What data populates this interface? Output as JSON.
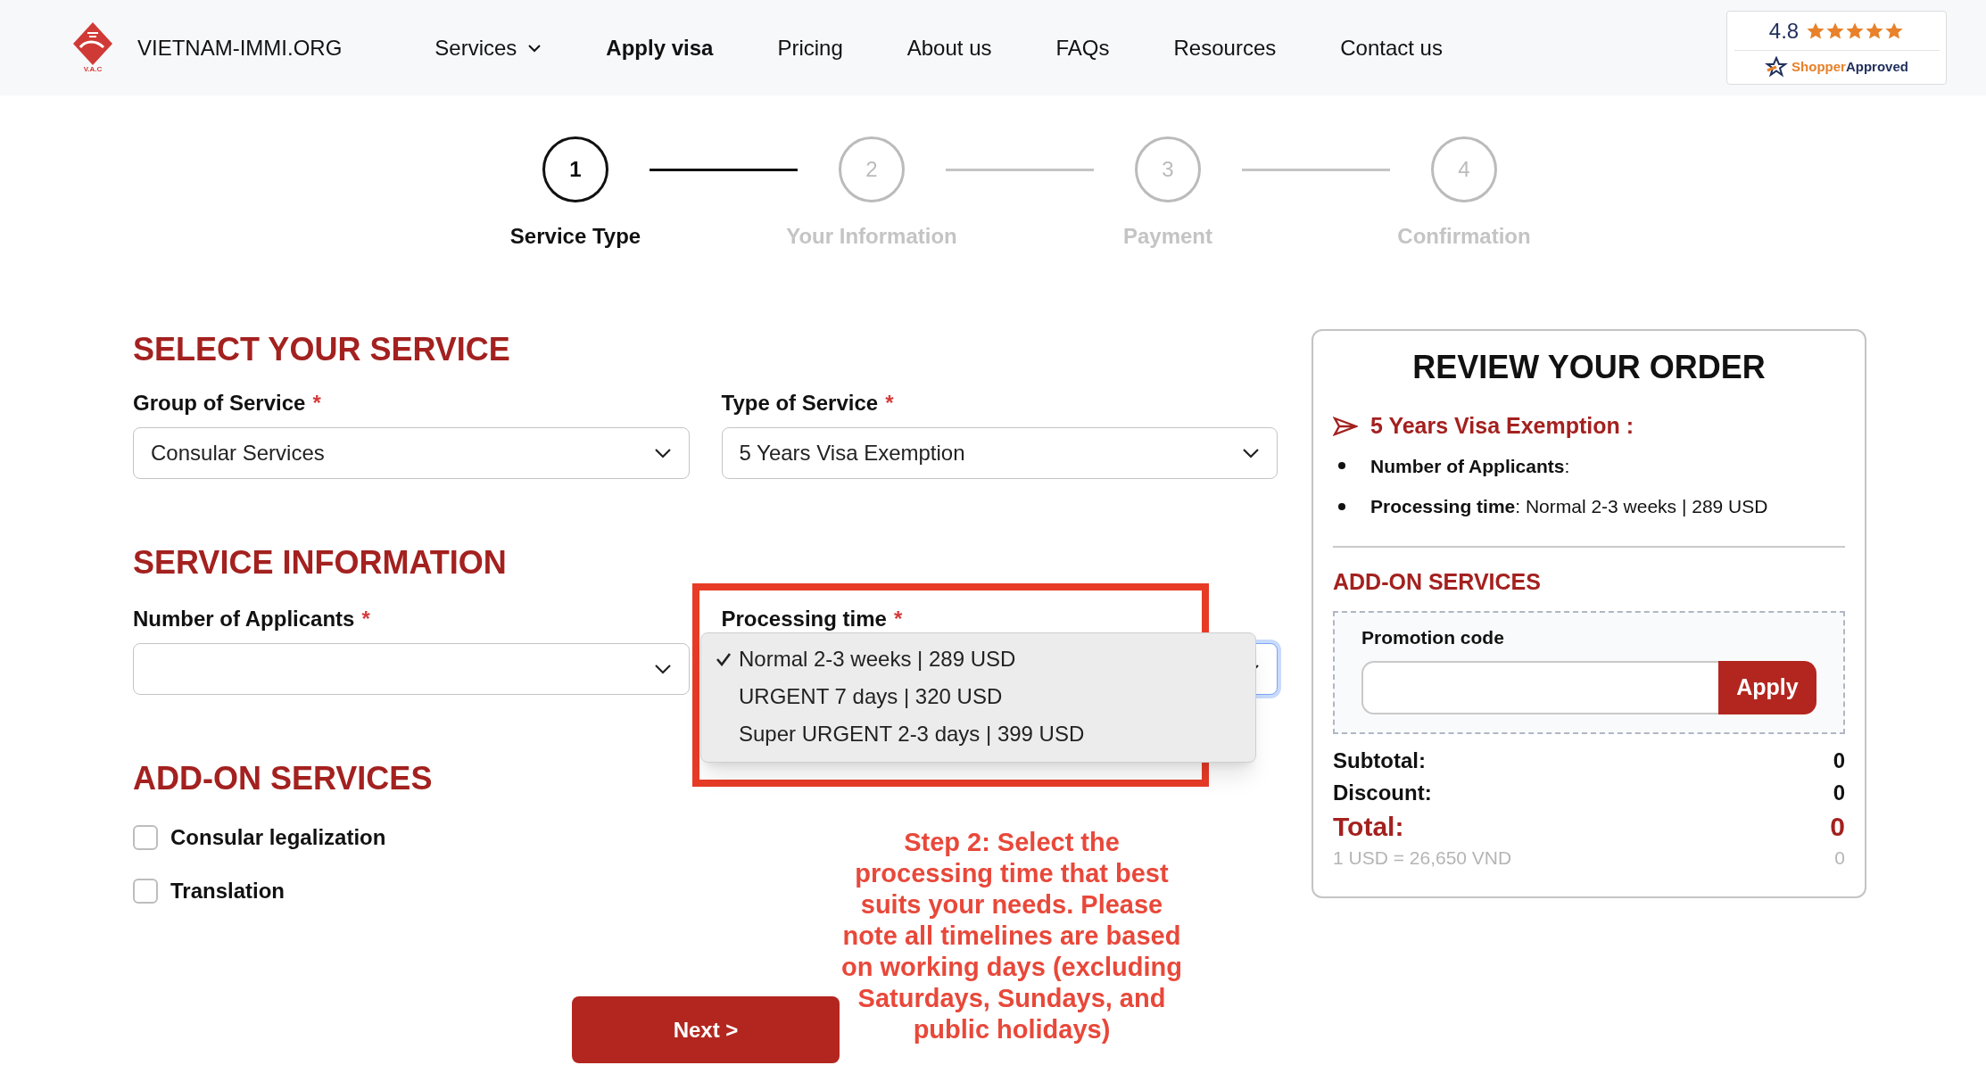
{
  "header": {
    "logo_caption": "V.A.C",
    "brand": "VIETNAM-IMMI.ORG",
    "nav": [
      {
        "label": "Services",
        "selected": false,
        "dropdown": true
      },
      {
        "label": "Apply visa",
        "selected": true,
        "dropdown": false
      },
      {
        "label": "Pricing",
        "selected": false,
        "dropdown": false
      },
      {
        "label": "About us",
        "selected": false,
        "dropdown": false
      },
      {
        "label": "FAQs",
        "selected": false,
        "dropdown": false
      },
      {
        "label": "Resources",
        "selected": false,
        "dropdown": false
      },
      {
        "label": "Contact us",
        "selected": false,
        "dropdown": false
      }
    ],
    "rating": {
      "score": "4.8",
      "stars": 5,
      "brand_first": "Shopper",
      "brand_second": "Approved"
    }
  },
  "steps": [
    {
      "number": "1",
      "label": "Service Type",
      "selected": true
    },
    {
      "number": "2",
      "label": "Your Information",
      "selected": false
    },
    {
      "number": "3",
      "label": "Payment",
      "selected": false
    },
    {
      "number": "4",
      "label": "Confirmation",
      "selected": false
    }
  ],
  "select_service": {
    "heading": "SELECT YOUR SERVICE",
    "fields": [
      {
        "label": "Group of Service",
        "required_mark": "*",
        "value": "Consular Services"
      },
      {
        "label": "Type of Service",
        "required_mark": "*",
        "value": "5 Years Visa Exemption"
      }
    ]
  },
  "service_information": {
    "heading": "SERVICE INFORMATION",
    "applicants": {
      "label": "Number of Applicants",
      "required_mark": "*"
    },
    "processing_time": {
      "label": "Processing time",
      "required_mark": "*",
      "options": [
        {
          "label": "Normal 2-3 weeks | 289 USD",
          "selected": true
        },
        {
          "label": "URGENT 7 days | 320 USD",
          "selected": false
        },
        {
          "label": "Super URGENT 2-3 days | 399 USD",
          "selected": false
        }
      ]
    }
  },
  "addons": {
    "heading": "ADD-ON SERVICES",
    "items": [
      {
        "label": "Consular legalization",
        "checked": false
      },
      {
        "label": "Translation",
        "checked": false
      }
    ]
  },
  "next_button": "Next >",
  "annotation": "Step 2: Select the processing time that best suits your needs. Please note all timelines are based on working days (excluding Saturdays, Sundays, and public holidays)",
  "review": {
    "title": "REVIEW YOUR ORDER",
    "service": "5 Years Visa Exemption :",
    "items": [
      "**Number of Applicants**:",
      "**Processing time**: Normal 2-3 weeks | 289 USD"
    ],
    "addons_heading": "ADD-ON SERVICES",
    "promo_label": "Promotion code",
    "apply_button": "Apply",
    "totals": [
      {
        "label": "Subtotal:",
        "value": "0",
        "kind": "normal"
      },
      {
        "label": "Discount:",
        "value": "0",
        "kind": "normal"
      },
      {
        "label": "Total:",
        "value": "0",
        "kind": "total"
      },
      {
        "label": "1 USD = 26,650 VND",
        "value": "0",
        "kind": "rate"
      }
    ]
  }
}
